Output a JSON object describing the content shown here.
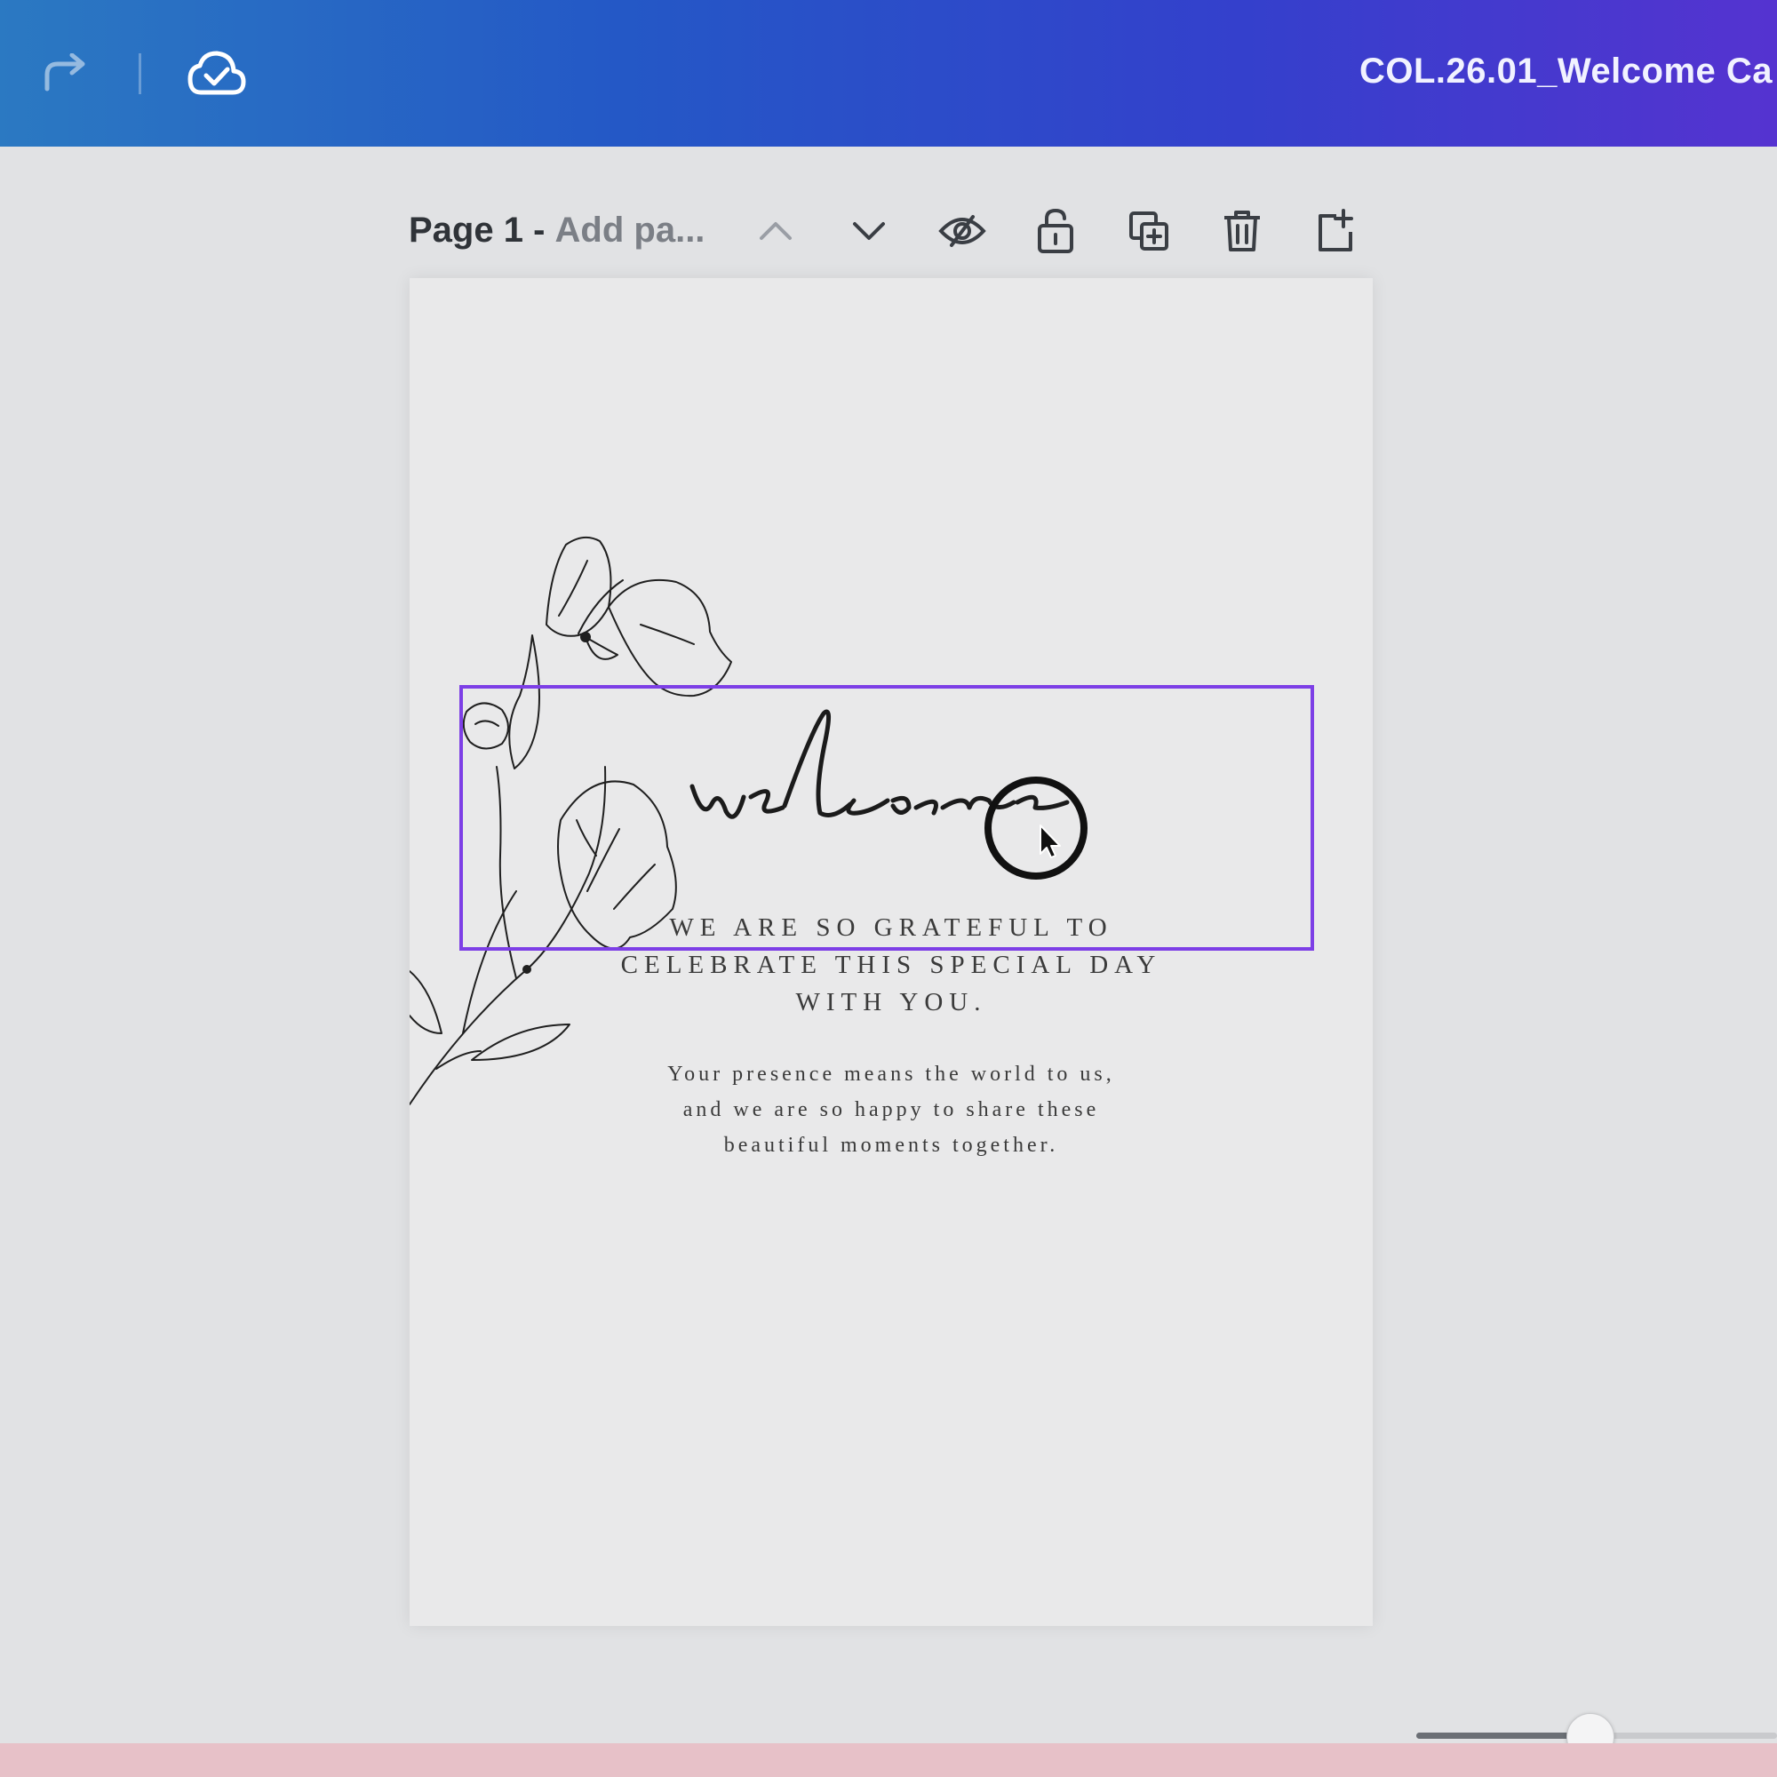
{
  "topbar": {
    "document_title": "COL.26.01_Welcome Ca",
    "icons": [
      "redo-icon",
      "cloud-saved-icon"
    ],
    "gradient": [
      "#2b79c2",
      "#5533d0"
    ]
  },
  "page_toolbar": {
    "page_number": "Page 1 -",
    "page_title_placeholder": "Add pa...",
    "icons": [
      "chevron-up-icon",
      "chevron-down-icon",
      "hide-icon",
      "lock-icon",
      "duplicate-icon",
      "trash-icon",
      "add-page-icon"
    ]
  },
  "card": {
    "script_word": "welcome",
    "heading_lines": [
      "WE ARE SO GRATEFUL TO",
      "CELEBRATE THIS SPECIAL DAY",
      "WITH YOU."
    ],
    "body_lines": [
      "Your presence means the world to us,",
      "and we are so happy to share these",
      "beautiful moments together."
    ],
    "selection_color": "#7d3fe6"
  },
  "zoom": {
    "level": 0.48
  }
}
